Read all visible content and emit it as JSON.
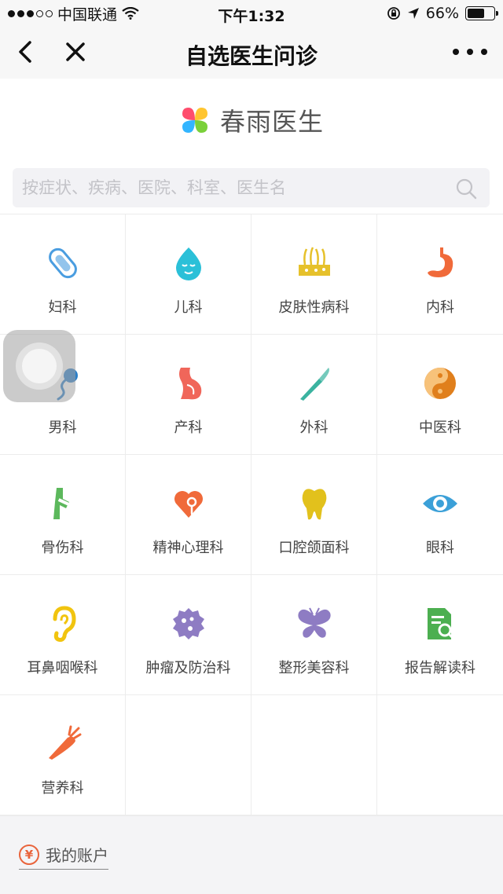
{
  "status_bar": {
    "carrier": "中国联通",
    "time": "下午1:32",
    "battery": "66%",
    "battery_level": 0.66
  },
  "nav": {
    "title": "自选医生问诊",
    "back_icon": "chevron-left-icon",
    "close_icon": "close-icon",
    "more_icon": "more-icon"
  },
  "brand": {
    "name": "春雨医生",
    "logo_colors": [
      "#ff4d6d",
      "#ffc530",
      "#33b5ff",
      "#7ad03a"
    ]
  },
  "search": {
    "placeholder": "按症状、疾病、医院、科室、医生名",
    "value": ""
  },
  "departments": [
    {
      "label": "妇科",
      "icon": "sanitary-pad-icon",
      "color": "#4a9de0"
    },
    {
      "label": "儿科",
      "icon": "baby-face-icon",
      "color": "#2bc0d8"
    },
    {
      "label": "皮肤性病科",
      "icon": "skin-icon",
      "color": "#e6c12b"
    },
    {
      "label": "内科",
      "icon": "stomach-icon",
      "color": "#f06a3a"
    },
    {
      "label": "男科",
      "icon": "sperm-icon",
      "color": "#2a7fc9"
    },
    {
      "label": "产科",
      "icon": "pregnant-icon",
      "color": "#f0665a"
    },
    {
      "label": "外科",
      "icon": "scalpel-icon",
      "color": "#3bb3a0"
    },
    {
      "label": "中医科",
      "icon": "yin-yang-icon",
      "color": "#e07f1c"
    },
    {
      "label": "骨伤科",
      "icon": "bone-joint-icon",
      "color": "#5cb85c"
    },
    {
      "label": "精神心理科",
      "icon": "heart-brain-icon",
      "color": "#f06a3a"
    },
    {
      "label": "口腔颌面科",
      "icon": "tooth-icon",
      "color": "#e2c11c"
    },
    {
      "label": "眼科",
      "icon": "eye-icon",
      "color": "#3ba0d8"
    },
    {
      "label": "耳鼻咽喉科",
      "icon": "ear-icon",
      "color": "#f1c40f"
    },
    {
      "label": "肿瘤及防治科",
      "icon": "tumor-cell-icon",
      "color": "#8e7cc3"
    },
    {
      "label": "整形美容科",
      "icon": "butterfly-icon",
      "color": "#8e7cc3"
    },
    {
      "label": "报告解读科",
      "icon": "report-search-icon",
      "color": "#4caf50"
    },
    {
      "label": "营养科",
      "icon": "carrot-icon",
      "color": "#f06a3a"
    }
  ],
  "footer": {
    "account_label": "我的账户",
    "account_icon": "yen-icon",
    "yen_symbol": "¥"
  }
}
